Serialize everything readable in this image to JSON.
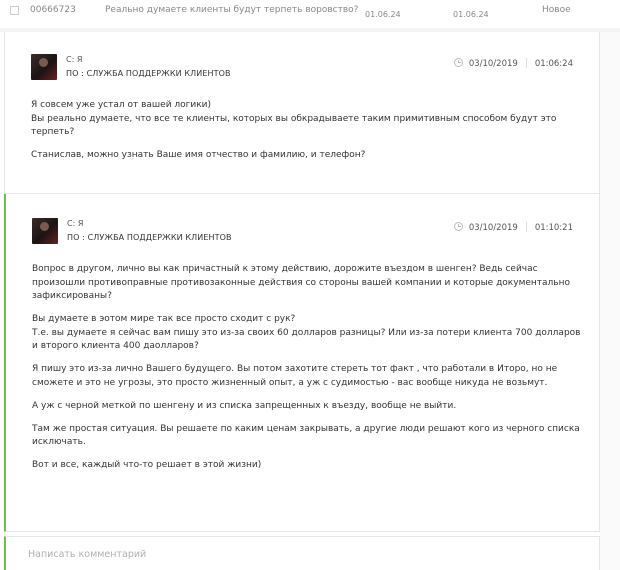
{
  "ticket_row": {
    "id": "00666723",
    "subject": "Реально думаете клиенты будут терпеть воровство?",
    "created_date": "01.06.24",
    "updated_date": "01.06.24",
    "status": "Новое"
  },
  "messages": [
    {
      "from": "С: Я",
      "to": "ПО : СЛУЖБА ПОДДЕРЖКИ КЛИЕНТОВ",
      "date": "03/10/2019",
      "time": "01:06:24",
      "paragraphs": [
        "Я совсем уже устал от вашей логики)\nВы реально думаете, что все те клиенты, которых вы обкрадываете таким примитивным способом будут это терпеть?",
        "Станислав, можно узнать Ваше имя отчество и фамилию, и телефон?"
      ]
    },
    {
      "from": "С: Я",
      "to": "ПО : СЛУЖБА ПОДДЕРЖКИ КЛИЕНТОВ",
      "date": "03/10/2019",
      "time": "01:10:21",
      "paragraphs": [
        "Вопрос в другом, лично вы как причастный к этому действию, дорожите въездом в шенген? Ведь сейчас произошли противоправные противозаконные действия со стороны вашей компании и которые документально зафиксированы?",
        "Вы думаете в эотом мире так все просто сходит с рук?\nТ.е. вы думаете я сейчас вам пишу это из-за своих 60 долларов разницы? Или из-за потери клиента 700 долларов и второго клиента 400 даолларов?",
        "Я пишу это из-за лично Вашего будущего. Вы потом захотите стереть тот факт , что работали в Итоpo, но не сможете и это не угрозы, это просто жизненный опыт, а уж с судимостью - вас вообще никуда не возьмут.",
        "А уж с черной меткой по шенгену и из списка запрещенных к въезду, вообще не выйти.",
        "Там же простая ситуация. Вы решаете по каким ценам закрывать, а другие люди решают кого из черного списка исключать.",
        "Вот и все, каждый что-то решает в этой жизни)"
      ]
    }
  ],
  "comment": {
    "placeholder": "Написать комментарий"
  },
  "colors": {
    "accent": "#6cbf4a",
    "border": "#e6e6e6",
    "text": "#333333"
  },
  "icons": {
    "clock": "clock-icon",
    "avatar": "avatar"
  }
}
